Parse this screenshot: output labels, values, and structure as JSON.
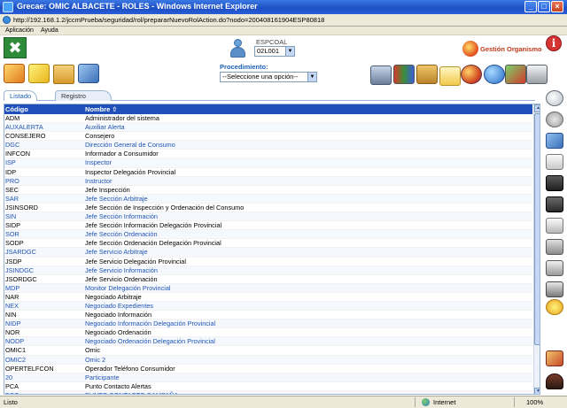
{
  "window": {
    "title": "Grecae: OMIC ALBACETE - ROLES - Windows Internet Explorer",
    "url": "http://192.168.1.2/jccmPrueba/seguridad/rol/prepararNuevoRolAction.do?nodo=200408161904ESP80818"
  },
  "menu": [
    "Aplicación",
    "Ayuda"
  ],
  "header": {
    "user_name": "ESPCOAL",
    "user_select_value": "02L001",
    "gestion_label": "Gestión Organismo",
    "procedimiento_label": "Procedimiento:",
    "procedimiento_value": "--Seleccione una opción--"
  },
  "tabs": [
    "Listado",
    "Registro"
  ],
  "table": {
    "headers": [
      "Código",
      "Nombre ⇧"
    ],
    "rows": [
      {
        "code": "ADM",
        "name": "Administrador del sistema",
        "link": false
      },
      {
        "code": "AUXALERTA",
        "name": "Auxiliar Alerta",
        "link": true
      },
      {
        "code": "CONSEJERO",
        "name": "Consejero",
        "link": false
      },
      {
        "code": "DGC",
        "name": "Dirección General de Consumo",
        "link": true
      },
      {
        "code": "INFCON",
        "name": "Informador a Consumidor",
        "link": false
      },
      {
        "code": "ISP",
        "name": "Inspector",
        "link": true
      },
      {
        "code": "IDP",
        "name": "Inspector Delegación Provincial",
        "link": false
      },
      {
        "code": "PRO",
        "name": "Instructor",
        "link": true
      },
      {
        "code": "SEC",
        "name": "Jefe Inspección",
        "link": false
      },
      {
        "code": "SAR",
        "name": "Jefe Sección Arbitraje",
        "link": true
      },
      {
        "code": "JSINSORD",
        "name": "Jefe Sección de Inspección y Ordenación del Consumo",
        "link": false
      },
      {
        "code": "SIN",
        "name": "Jefe Sección Información",
        "link": true
      },
      {
        "code": "SIDP",
        "name": "Jefe Sección Información Delegación Provincial",
        "link": false
      },
      {
        "code": "SOR",
        "name": "Jefe Sección Ordenación",
        "link": true
      },
      {
        "code": "SODP",
        "name": "Jefe Sección Ordenación Delegación Provincial",
        "link": false
      },
      {
        "code": "JSARDGC",
        "name": "Jefe Servicio Arbitraje",
        "link": true
      },
      {
        "code": "JSDP",
        "name": "Jefe Servicio Delegación Provincial",
        "link": false
      },
      {
        "code": "JSINDGC",
        "name": "Jefe Servicio Información",
        "link": true
      },
      {
        "code": "JSORDGC",
        "name": "Jefe Servicio Ordenación",
        "link": false
      },
      {
        "code": "MDP",
        "name": "Monitor Delegación Provincial",
        "link": true
      },
      {
        "code": "NAR",
        "name": "Negociado Arbitraje",
        "link": false
      },
      {
        "code": "NEX",
        "name": "Negociado Expedientes",
        "link": true
      },
      {
        "code": "NIN",
        "name": "Negociado Información",
        "link": false
      },
      {
        "code": "NIDP",
        "name": "Negociado Información Delegación Provincial",
        "link": true
      },
      {
        "code": "NOR",
        "name": "Negociado Ordenación",
        "link": false
      },
      {
        "code": "NODP",
        "name": "Negociado Ordenación Delegación Provincial",
        "link": true
      },
      {
        "code": "OMIC1",
        "name": "Omic",
        "link": false
      },
      {
        "code": "OMIC2",
        "name": "Omic 2",
        "link": true
      },
      {
        "code": "OPERTELFCON",
        "name": "Operador Teléfono Consumidor",
        "link": false
      },
      {
        "code": "20",
        "name": "Participante",
        "link": true
      },
      {
        "code": "PCA",
        "name": "Punto Contacto Alertas",
        "link": false
      },
      {
        "code": "PCC",
        "name": "PUNTO CONTACTO CAMPAÑA",
        "link": true
      }
    ]
  },
  "status": {
    "left": "Listo",
    "zone": "Internet",
    "zoom": "100%"
  },
  "icons": {
    "toolbar_left": [
      "edit-icon",
      "folder-new-icon",
      "folder-icon",
      "save-icon"
    ],
    "toolbar_right": [
      "computer-icon",
      "books-icon",
      "archive-icon",
      "mail-icon",
      "globe-icon",
      "search-icon",
      "tools-icon",
      "print-icon"
    ],
    "side": [
      "magnify-icon",
      "back-icon",
      "edit-icon",
      "copy-icon",
      "disk-icon",
      "delete-icon",
      "paste-icon",
      "clipboard-icon",
      "printer-icon",
      "report-icon",
      "settings-icon",
      "tools-icon",
      "exit-icon"
    ]
  },
  "colors": {
    "accent": "#1f4fb8",
    "link": "#1f55b5",
    "brand_red": "#c0381a"
  }
}
